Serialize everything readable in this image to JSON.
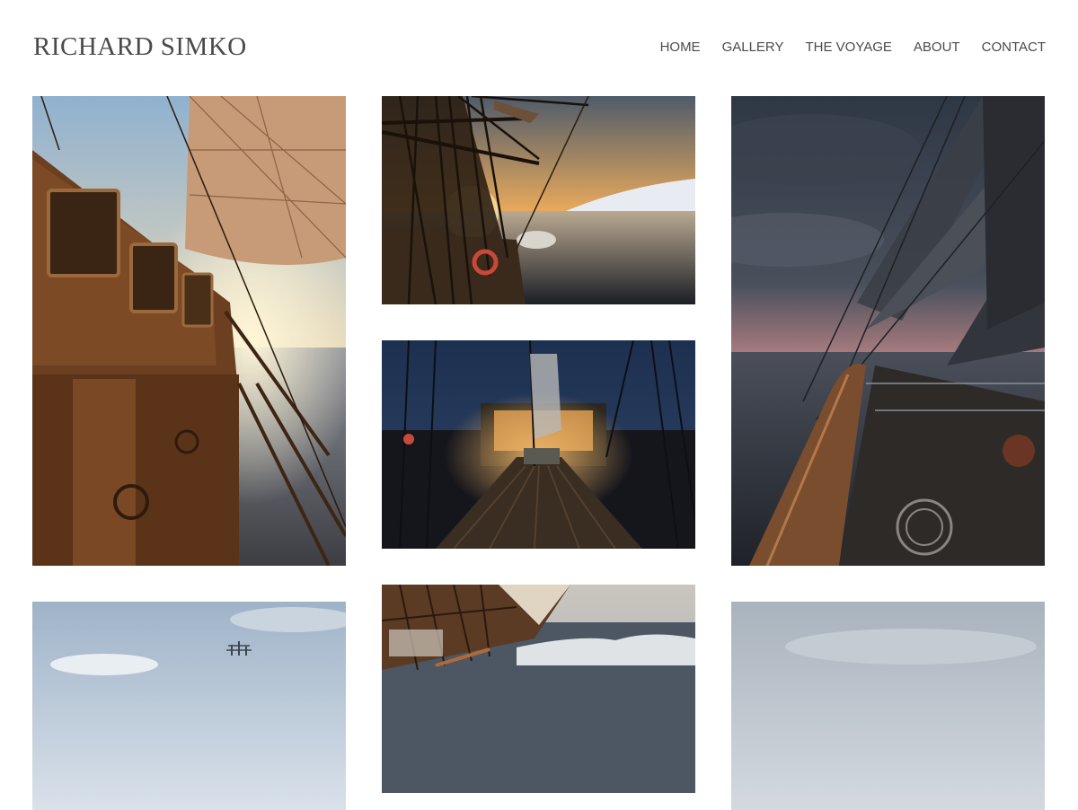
{
  "site": {
    "title": "RICHARD SIMKO"
  },
  "nav": {
    "items": [
      {
        "label": "HOME"
      },
      {
        "label": "GALLERY"
      },
      {
        "label": "THE VOYAGE"
      },
      {
        "label": "ABOUT"
      },
      {
        "label": "CONTACT"
      }
    ]
  },
  "gallery": {
    "photos": [
      {
        "subject": "ship-wheelhouse-at-sunset"
      },
      {
        "subject": "rigging-sunset-icy-coast"
      },
      {
        "subject": "stormy-sky-sails-over-sea"
      },
      {
        "subject": "night-deck-with-lights"
      },
      {
        "subject": "distant-tall-ship-on-horizon"
      },
      {
        "subject": "ship-heeling-in-rough-sea"
      },
      {
        "subject": "overcast-sea"
      }
    ]
  },
  "colors": {
    "text": "#4a4a4a",
    "background": "#ffffff"
  }
}
